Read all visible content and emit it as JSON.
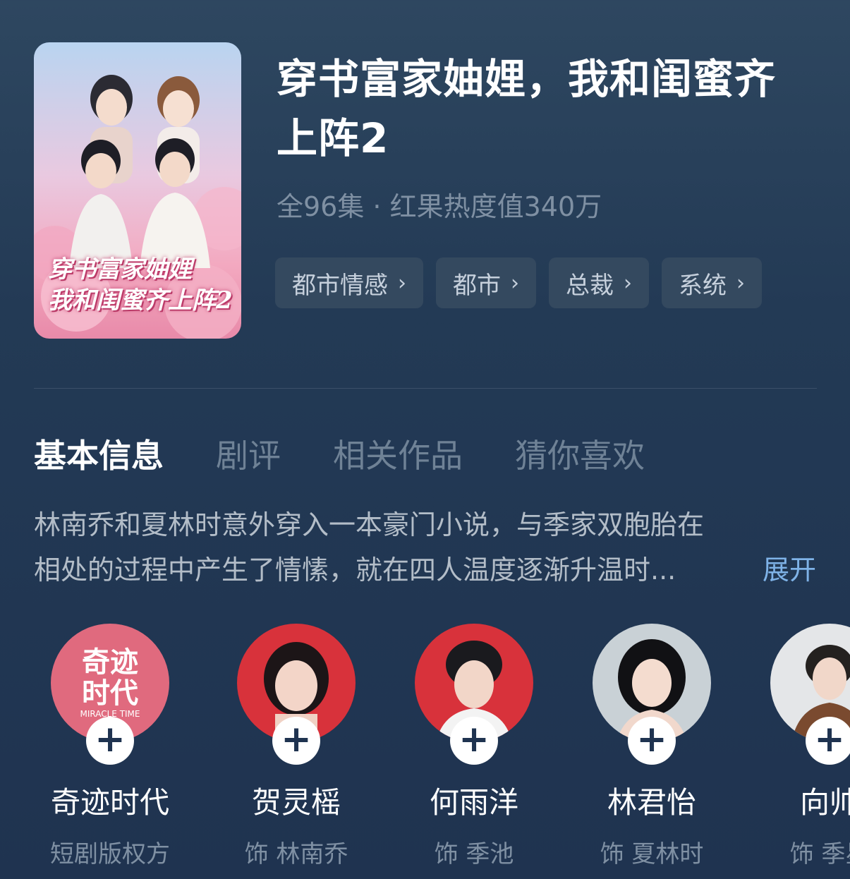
{
  "drama": {
    "title": "穿书富家妯娌，我和闺蜜齐上阵2",
    "meta": "全96集 · 红果热度值340万",
    "poster_title_line1": "穿书富家妯娌",
    "poster_title_line2": "我和闺蜜齐上阵2"
  },
  "tags": [
    {
      "label": "都市情感"
    },
    {
      "label": "都市"
    },
    {
      "label": "总裁"
    },
    {
      "label": "系统"
    }
  ],
  "tabs": [
    {
      "label": "基本信息",
      "active": true
    },
    {
      "label": "剧评"
    },
    {
      "label": "相关作品"
    },
    {
      "label": "猜你喜欢"
    }
  ],
  "description": "林南乔和夏林时意外穿入一本豪门小说，与季家双胞胎在相处的过程中产生了情愫，就在四人温度逐渐升温时...",
  "expand_label": "展开",
  "company_logo": {
    "line1": "奇迹",
    "line2": "时代",
    "english": "MIRACLE TIME"
  },
  "cast": [
    {
      "name": "奇迹时代",
      "role": "短剧版权方"
    },
    {
      "name": "贺灵榣",
      "role": "饰 林南乔"
    },
    {
      "name": "何雨洋",
      "role": "饰 季池"
    },
    {
      "name": "林君怡",
      "role": "饰 夏林时"
    },
    {
      "name": "向帅",
      "role": "饰 季星"
    }
  ],
  "plus_symbol": "+",
  "chevron": "›",
  "colors": {
    "background": "#233a55",
    "tag_bg": "#34495f",
    "muted": "#7f90a3",
    "link": "#7fb3e8",
    "logo_pink": "#e06a7e",
    "red_bg": "#d8323b"
  }
}
